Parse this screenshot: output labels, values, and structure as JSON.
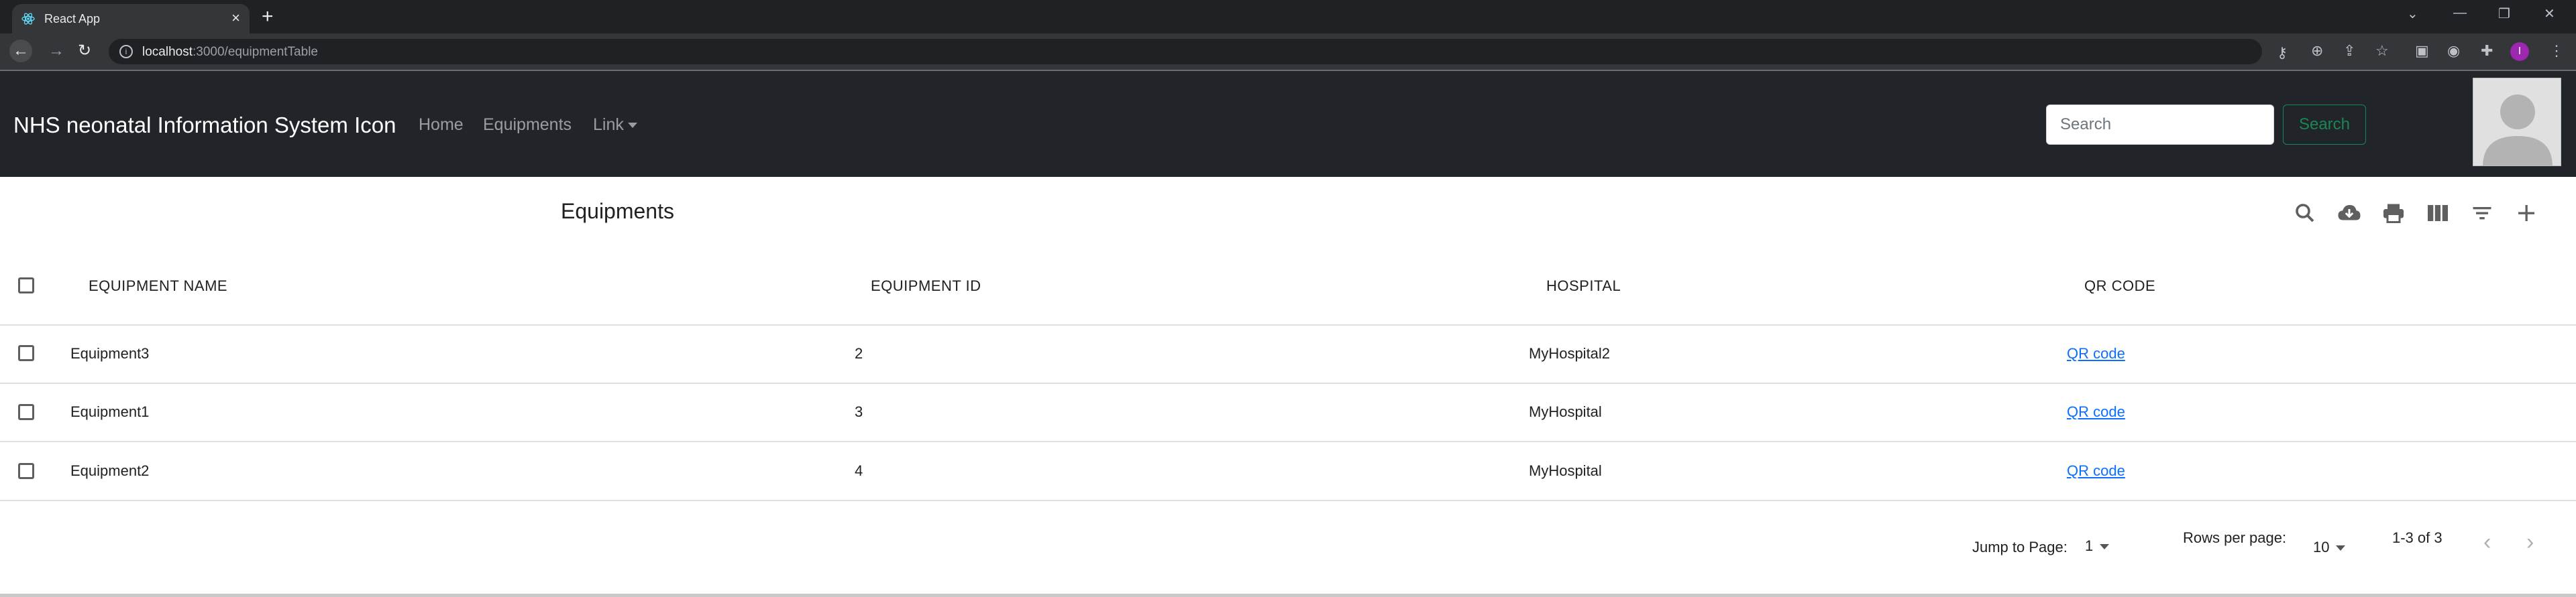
{
  "browser": {
    "tab_title": "React App",
    "url_host": "localhost",
    "url_rest": ":3000/equipmentTable",
    "profile_initial": "I"
  },
  "navbar": {
    "brand": "NHS neonatal Information System Icon",
    "links": [
      "Home",
      "Equipments",
      "Link"
    ],
    "search_placeholder": "Search",
    "search_button": "Search"
  },
  "table": {
    "title": "Equipments",
    "columns": [
      "EQUIPMENT NAME",
      "EQUIPMENT ID",
      "HOSPITAL",
      "QR CODE"
    ],
    "rows": [
      {
        "name": "Equipment3",
        "id": "2",
        "hospital": "MyHospital2",
        "qr": "QR code"
      },
      {
        "name": "Equipment1",
        "id": "3",
        "hospital": "MyHospital",
        "qr": "QR code"
      },
      {
        "name": "Equipment2",
        "id": "4",
        "hospital": "MyHospital",
        "qr": "QR code"
      }
    ],
    "toolbar_icons": [
      "search-icon",
      "cloud-download-icon",
      "print-icon",
      "view-columns-icon",
      "filter-icon",
      "add-icon"
    ]
  },
  "pagination": {
    "jump_label": "Jump to Page:",
    "jump_value": "1",
    "rows_label": "Rows per page:",
    "rows_value": "10",
    "range": "1-3 of 3"
  }
}
